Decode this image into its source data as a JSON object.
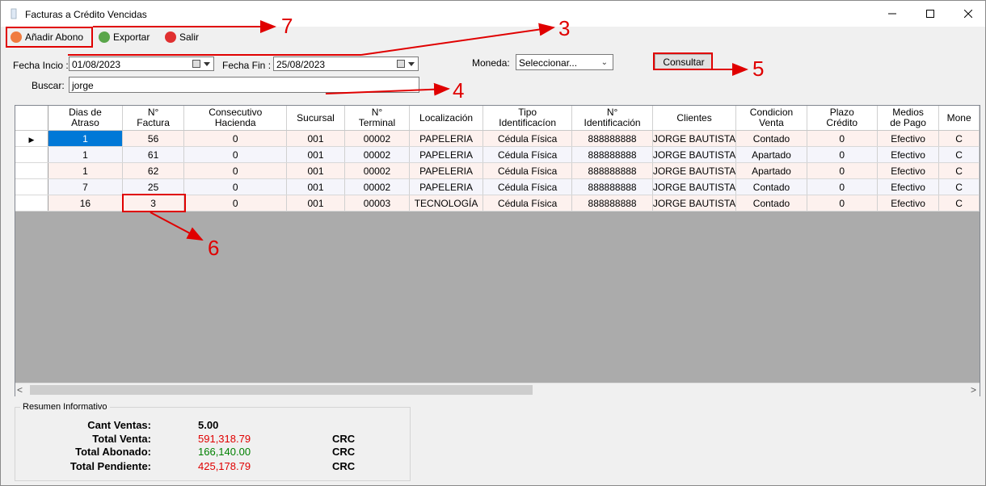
{
  "window": {
    "title": "Facturas a Crédito Vencidas"
  },
  "toolbar": {
    "add_payment_label": "Añadir Abono",
    "export_label": "Exportar",
    "exit_label": "Salir"
  },
  "filters": {
    "start_date_label": "Fecha Incio :",
    "start_date_value": "01/08/2023",
    "end_date_label": "Fecha Fin :",
    "end_date_value": "25/08/2023",
    "currency_label": "Moneda:",
    "currency_value": "Seleccionar...",
    "search_label": "Buscar:",
    "search_value": "jorge",
    "consult_label": "Consultar"
  },
  "grid": {
    "columns": [
      "Dias de\nAtraso",
      "N°\nFactura",
      "Consecutivo\nHacienda",
      "Sucursal",
      "N°\nTerminal",
      "Localización",
      "Tipo\nIdentificacíon",
      "N°\nIdentificación",
      "Clientes",
      "Condicion\nVenta",
      "Plazo\nCrédito",
      "Medios\nde Pago",
      "Mone"
    ],
    "rows": [
      [
        "1",
        "56",
        "0",
        "001",
        "00002",
        "PAPELERIA",
        "Cédula Física",
        "888888888",
        "JORGE BAUTISTA",
        "Contado",
        "0",
        "Efectivo",
        "C"
      ],
      [
        "1",
        "61",
        "0",
        "001",
        "00002",
        "PAPELERIA",
        "Cédula Física",
        "888888888",
        "JORGE BAUTISTA",
        "Apartado",
        "0",
        "Efectivo",
        "C"
      ],
      [
        "1",
        "62",
        "0",
        "001",
        "00002",
        "PAPELERIA",
        "Cédula Física",
        "888888888",
        "JORGE BAUTISTA",
        "Apartado",
        "0",
        "Efectivo",
        "C"
      ],
      [
        "7",
        "25",
        "0",
        "001",
        "00002",
        "PAPELERIA",
        "Cédula Física",
        "888888888",
        "JORGE BAUTISTA",
        "Contado",
        "0",
        "Efectivo",
        "C"
      ],
      [
        "16",
        "3",
        "0",
        "001",
        "00003",
        "TECNOLOGÍA",
        "Cédula Física",
        "888888888",
        "JORGE BAUTISTA",
        "Contado",
        "0",
        "Efectivo",
        "C"
      ]
    ]
  },
  "summary": {
    "title": "Resumen Informativo",
    "cant_ventas_label": "Cant Ventas:",
    "cant_ventas_value": "5.00",
    "total_venta_label": "Total Venta:",
    "total_venta_value": "591,318.79",
    "total_venta_currency": "CRC",
    "total_abonado_label": "Total Abonado:",
    "total_abonado_value": "166,140.00",
    "total_abonado_currency": "CRC",
    "total_pendiente_label": "Total Pendiente:",
    "total_pendiente_value": "425,178.79",
    "total_pendiente_currency": "CRC"
  },
  "annotations": {
    "n3": "3",
    "n4": "4",
    "n5": "5",
    "n6": "6",
    "n7": "7"
  },
  "colors": {
    "annotation": "#e00000",
    "selection": "#0078d7",
    "red_value": "#e00000",
    "green_value": "#008000"
  }
}
